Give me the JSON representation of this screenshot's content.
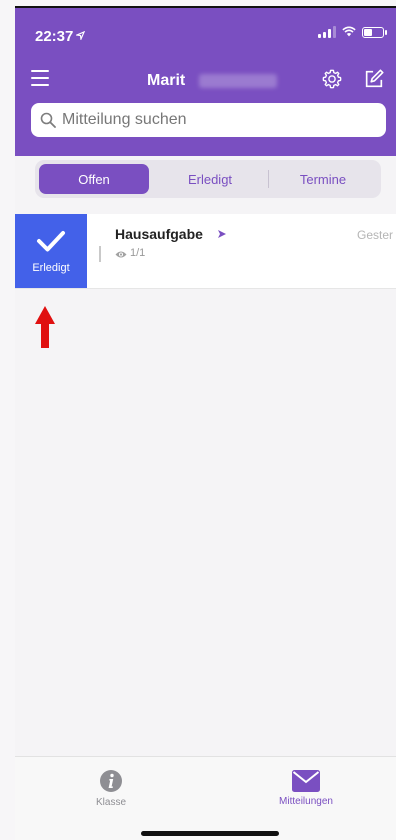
{
  "status_bar": {
    "time": "22:37"
  },
  "header": {
    "title": "Marit"
  },
  "search": {
    "placeholder": "Mitteilung suchen"
  },
  "segments": [
    "Offen",
    "Erledigt",
    "Termine"
  ],
  "active_segment": "Offen",
  "message": {
    "title": "Hausaufgabe",
    "read_count": "1/1",
    "date": "Gester",
    "swipe_action_label": "Erledigt"
  },
  "tabs": [
    {
      "label": "Klasse",
      "icon": "info-icon"
    },
    {
      "label": "Mitteilungen",
      "icon": "mail-icon"
    }
  ],
  "colors": {
    "brand_purple": "#7a4fc1",
    "swipe_blue": "#4361e9",
    "annotation_red": "#e01010",
    "inactive_gray": "#8e8e93"
  }
}
